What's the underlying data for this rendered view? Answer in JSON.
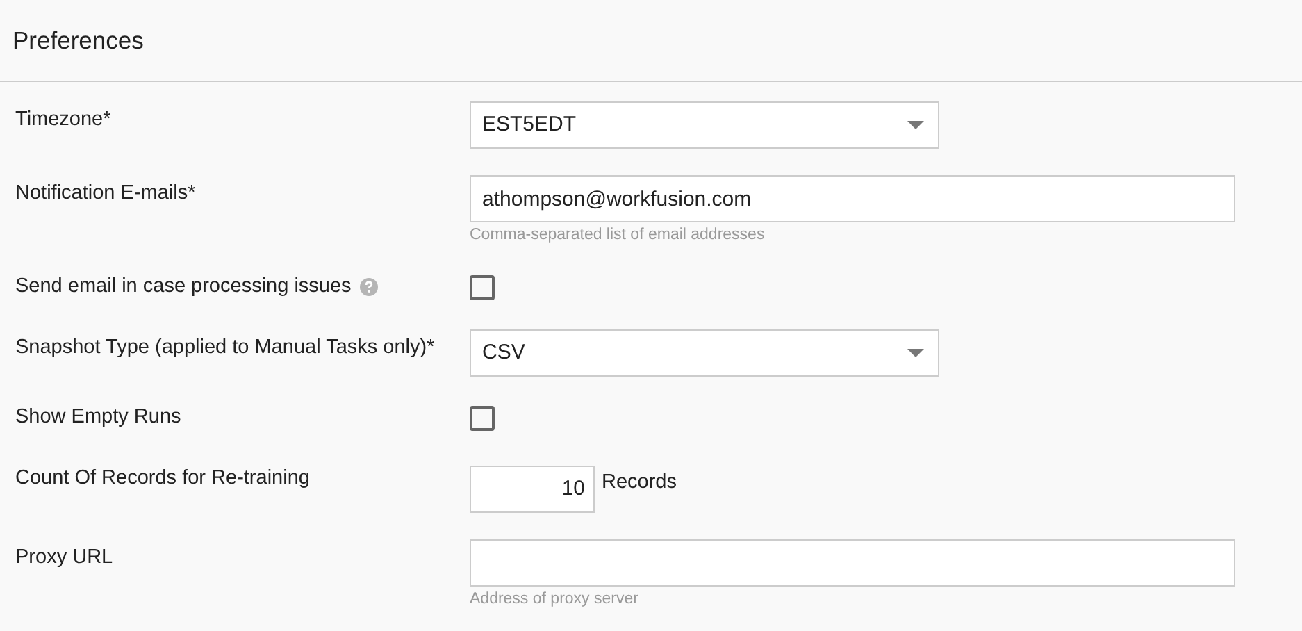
{
  "title": "Preferences",
  "fields": [
    {
      "kind": "select",
      "label": "Timezone*",
      "value": "EST5EDT"
    },
    {
      "kind": "text",
      "label": "Notification E-mails*",
      "value": "athompson@workfusion.com",
      "hint": "Comma-separated list of email addresses"
    },
    {
      "kind": "checkbox",
      "label": "Send email in case processing issues",
      "help": true,
      "checked": false
    },
    {
      "kind": "select",
      "label": "Snapshot Type (applied to Manual Tasks only)*",
      "value": "CSV"
    },
    {
      "kind": "checkbox",
      "label": "Show Empty Runs",
      "checked": false
    },
    {
      "kind": "number",
      "label": "Count Of Records for Re-training",
      "value": "10",
      "unit": "Records"
    },
    {
      "kind": "text",
      "label": "Proxy URL",
      "hint": "Address of proxy server"
    }
  ]
}
